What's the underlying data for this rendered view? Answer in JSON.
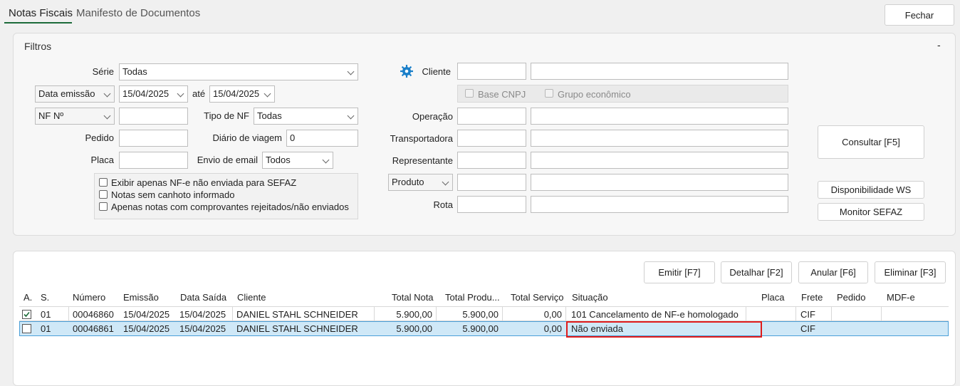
{
  "tabs": [
    {
      "label": "Notas Fiscais",
      "active": true
    },
    {
      "label": "Manifesto de Documentos",
      "active": false
    }
  ],
  "close_button": "Fechar",
  "filters": {
    "title": "Filtros",
    "collapse": "-",
    "serie_label": "Série",
    "serie_value": "Todas",
    "date_type": "Data emissão",
    "date_from": "15/04/2025",
    "ate_label": "até",
    "date_to": "15/04/2025",
    "nf_type": "NF Nº",
    "nf_value": "",
    "tipo_nf_label": "Tipo de NF",
    "tipo_nf_value": "Todas",
    "pedido_label": "Pedido",
    "diario_label": "Diário de viagem",
    "diario_value": "0",
    "placa_label": "Placa",
    "envio_email_label": "Envio de email",
    "envio_email_value": "Todos",
    "checkboxes": [
      "Exibir apenas NF-e não enviada para SEFAZ",
      "Notas sem canhoto informado",
      "Apenas notas com comprovantes rejeitados/não enviados"
    ],
    "cliente_label": "Cliente",
    "base_cnpj": "Base CNPJ",
    "grupo_economico": "Grupo econômico",
    "operacao_label": "Operação",
    "transportadora_label": "Transportadora",
    "representante_label": "Representante",
    "produto_type": "Produto",
    "rota_label": "Rota",
    "consultar": "Consultar [F5]",
    "disponibilidade": "Disponibilidade WS",
    "monitor": "Monitor SEFAZ"
  },
  "actions": [
    "Emitir [F7]",
    "Detalhar [F2]",
    "Anular [F6]",
    "Eliminar [F3]"
  ],
  "table": {
    "columns": [
      "A.",
      "S.",
      "Número",
      "Emissão",
      "Data Saída",
      "Cliente",
      "Total Nota",
      "Total Produ...",
      "Total Serviço",
      "Situação",
      "Placa",
      "Frete",
      "Pedido",
      "MDF-e"
    ],
    "rows": [
      {
        "checked": true,
        "serie": "01",
        "numero": "00046860",
        "emissao": "15/04/2025",
        "saida": "15/04/2025",
        "cliente": "DANIEL STAHL SCHNEIDER",
        "total_nota": "5.900,00",
        "total_prod": "5.900,00",
        "total_serv": "0,00",
        "situacao": "101 Cancelamento de NF-e homologado",
        "placa": "",
        "frete": "CIF",
        "pedido": "",
        "mdfe": ""
      },
      {
        "checked": false,
        "serie": "01",
        "numero": "00046861",
        "emissao": "15/04/2025",
        "saida": "15/04/2025",
        "cliente": "DANIEL STAHL SCHNEIDER",
        "total_nota": "5.900,00",
        "total_prod": "5.900,00",
        "total_serv": "0,00",
        "situacao": "Não enviada",
        "placa": "",
        "frete": "CIF",
        "pedido": "",
        "mdfe": ""
      }
    ]
  },
  "colors": {
    "accent": "#1d6b3a",
    "selected_row": "#cfe8f7",
    "highlight_box": "#e01b1b"
  }
}
